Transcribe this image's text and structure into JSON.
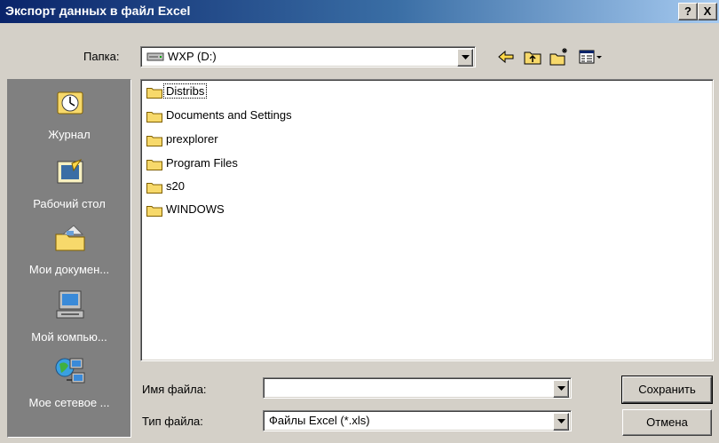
{
  "window": {
    "title": "Экспорт данных в файл Excel",
    "help_label": "?",
    "close_label": "X"
  },
  "folder": {
    "label": "Папка:",
    "value": "WXP (D:)"
  },
  "places": [
    {
      "label": "Журнал",
      "icon": "history-icon"
    },
    {
      "label": "Рабочий стол",
      "icon": "desktop-icon"
    },
    {
      "label": "Мои докумен...",
      "icon": "my-documents-icon"
    },
    {
      "label": "Мой компью...",
      "icon": "my-computer-icon"
    },
    {
      "label": "Мое сетевое ...",
      "icon": "network-places-icon"
    }
  ],
  "files": [
    {
      "name": "Distribs"
    },
    {
      "name": "Documents and Settings"
    },
    {
      "name": "prexplorer"
    },
    {
      "name": "Program Files"
    },
    {
      "name": "s20"
    },
    {
      "name": "WINDOWS"
    }
  ],
  "filename": {
    "label": "Имя файла:",
    "value": ""
  },
  "filetype": {
    "label": "Тип файла:",
    "value": "Файлы Excel (*.xls)"
  },
  "buttons": {
    "save": "Сохранить",
    "cancel": "Отмена"
  },
  "colors": {
    "title_start": "#0a246a",
    "title_end": "#a6caf0",
    "face": "#d4d0c8",
    "places_bg": "#808080",
    "folder_yellow": "#f7d96b"
  }
}
